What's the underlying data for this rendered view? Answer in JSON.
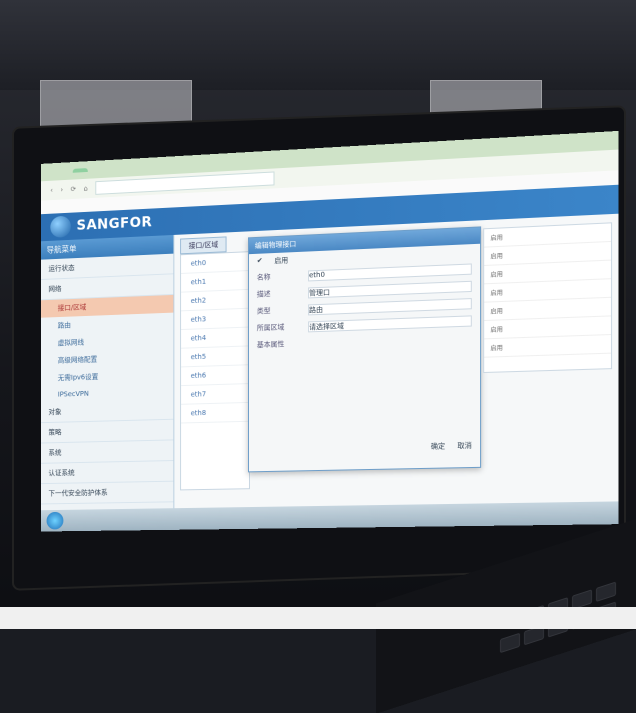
{
  "app": {
    "brand": "SANGFOR"
  },
  "sidebar": {
    "title": "导航菜单",
    "sections": [
      {
        "label": "运行状态"
      },
      {
        "label": "网络"
      }
    ],
    "subitems": [
      {
        "label": "接口/区域",
        "active": true
      },
      {
        "label": "路由",
        "active": false
      },
      {
        "label": "虚拟网线",
        "active": false
      },
      {
        "label": "高级网络配置",
        "active": false
      },
      {
        "label": "无需Ipv6设置",
        "active": false
      },
      {
        "label": "IPSecVPN",
        "active": false
      }
    ],
    "bottom": [
      {
        "label": "对象"
      },
      {
        "label": "策略"
      },
      {
        "label": "系统"
      },
      {
        "label": "认证系统"
      },
      {
        "label": "下一代安全防护体系"
      }
    ]
  },
  "main": {
    "tab": "接口/区域",
    "list": [
      "eth0",
      "eth1",
      "eth2",
      "eth3",
      "eth4",
      "eth5",
      "eth6",
      "eth7",
      "eth8"
    ]
  },
  "dialog": {
    "title": "编辑物理接口",
    "enable_label": "启用",
    "fields": [
      {
        "label": "名称",
        "value": "eth0"
      },
      {
        "label": "描述",
        "value": "管理口"
      },
      {
        "label": "类型",
        "value": "路由"
      },
      {
        "label": "所属区域",
        "value": "请选择区域"
      },
      {
        "label": "基本属性",
        "value": ""
      }
    ],
    "confirm": "确定",
    "cancel": "取消"
  },
  "right_grid": {
    "rows": [
      "启用",
      "启用",
      "启用",
      "启用",
      "启用",
      "启用",
      "启用"
    ]
  },
  "colors": {
    "header": "#2c6fb3",
    "active": "#f4c9b0"
  }
}
